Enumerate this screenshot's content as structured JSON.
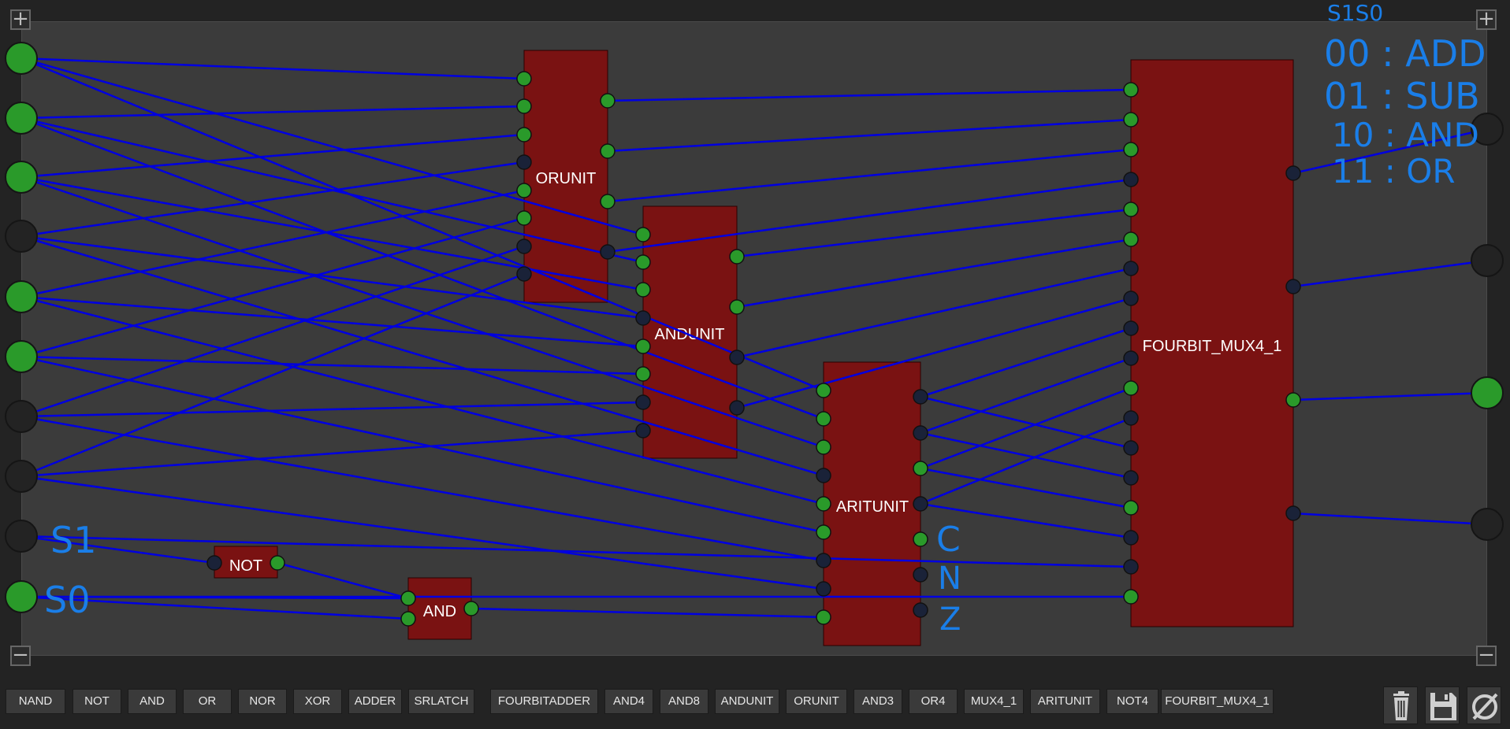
{
  "colors": {
    "board": "#3b3b3b",
    "wire": "#0000e0",
    "chip": "#7a1212",
    "pin_on": "#2a9a2a",
    "pin_off": "#1a2238",
    "annotation": "#1a7ee8"
  },
  "board": {
    "zoom_in_top_left": "+",
    "zoom_in_top_right": "+",
    "zoom_out_bottom_left": "−",
    "zoom_out_bottom_right": "−"
  },
  "chips": {
    "orunit": "ORUNIT",
    "andunit": "ANDUNIT",
    "aritunit": "ARITUNIT",
    "mux": "FOURBIT_MUX4_1",
    "not": "NOT",
    "and": "AND"
  },
  "inputs": [
    {
      "state": "on"
    },
    {
      "state": "on"
    },
    {
      "state": "on"
    },
    {
      "state": "off"
    },
    {
      "state": "on"
    },
    {
      "state": "on"
    },
    {
      "state": "off"
    },
    {
      "state": "off"
    },
    {
      "state": "off"
    },
    {
      "state": "on"
    }
  ],
  "outputs": [
    {
      "state": "off"
    },
    {
      "state": "off"
    },
    {
      "state": "on"
    },
    {
      "state": "off"
    }
  ],
  "annotations": {
    "header": "S1S0",
    "line1": "00 : ADD",
    "line2": "01 : SUB",
    "line3": "10 : AND",
    "line4": "11 : OR",
    "s1": "S1",
    "s0": "S0",
    "c": "C",
    "n": "N",
    "z": "Z"
  },
  "toolbar": {
    "chips": [
      "NAND",
      "NOT",
      "AND",
      "OR",
      "NOR",
      "XOR",
      "ADDER",
      "SRLATCH",
      "FOURBITADDER",
      "AND4",
      "AND8",
      "ANDUNIT",
      "ORUNIT",
      "AND3",
      "OR4",
      "MUX4_1",
      "ARITUNIT",
      "NOT4",
      "FOURBIT_MUX4_1"
    ],
    "actions": {
      "delete": "trash-icon",
      "save": "save-icon",
      "clear": "clear-icon"
    }
  }
}
